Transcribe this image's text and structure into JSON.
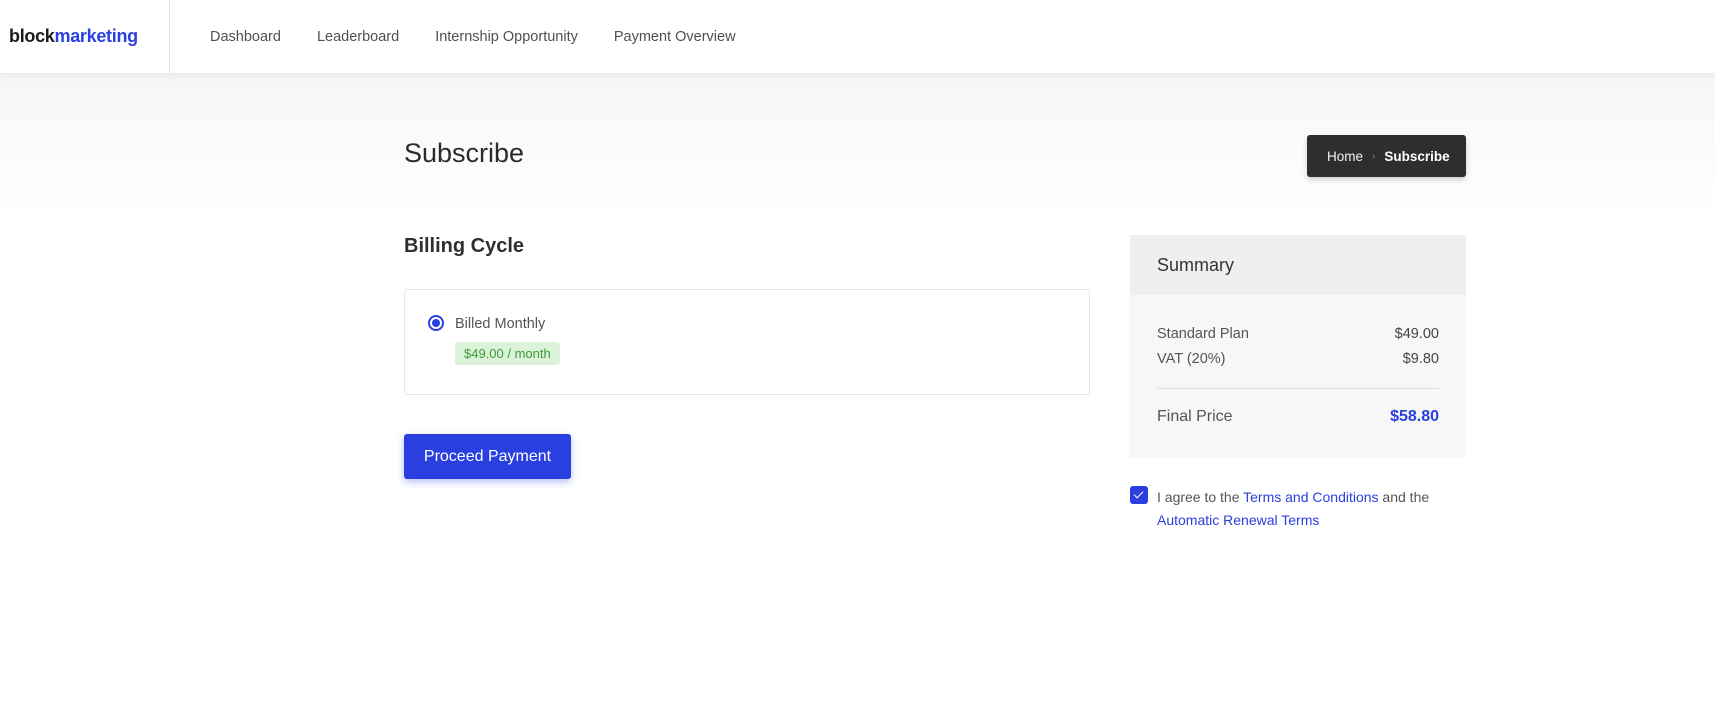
{
  "brand": {
    "part1": "block",
    "part2": "marketing"
  },
  "nav": {
    "items": [
      "Dashboard",
      "Leaderboard",
      "Internship Opportunity",
      "Payment Overview"
    ]
  },
  "page": {
    "title": "Subscribe"
  },
  "breadcrumb": {
    "home": "Home",
    "separator": "›",
    "current": "Subscribe"
  },
  "billing": {
    "title": "Billing Cycle",
    "option_label": "Billed Monthly",
    "option_price": "$49.00 / month",
    "selected": true
  },
  "actions": {
    "proceed_label": "Proceed Payment"
  },
  "summary": {
    "title": "Summary",
    "rows": [
      {
        "label": "Standard Plan",
        "value": "$49.00"
      },
      {
        "label": "VAT (20%)",
        "value": "$9.80"
      }
    ],
    "final_label": "Final Price",
    "final_value": "$58.80"
  },
  "terms": {
    "checked": true,
    "prefix": "I agree to the ",
    "link1": "Terms and Conditions",
    "middle": " and the ",
    "link2": "Automatic Renewal Terms"
  },
  "colors": {
    "accent": "#2a3fe0",
    "price_badge_bg": "#dbf3d8",
    "price_badge_text": "#3f9a3c",
    "breadcrumb_bg": "#2e2e2e"
  }
}
